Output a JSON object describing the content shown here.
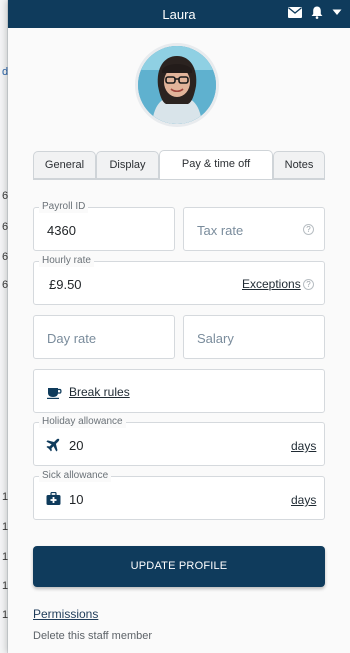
{
  "background_app": {
    "fragments": [
      "d",
      "6",
      "6",
      "6",
      "6",
      "1",
      "1",
      "1",
      "1",
      "1"
    ]
  },
  "header": {
    "title": "Laura",
    "icons": [
      "envelope-icon",
      "bell-icon",
      "chevron-down-icon"
    ]
  },
  "profile": {
    "avatar": "profile-photo"
  },
  "tabs": [
    {
      "label": "General",
      "active": false
    },
    {
      "label": "Display",
      "active": false
    },
    {
      "label": "Pay & time off",
      "active": true
    },
    {
      "label": "Notes",
      "active": false
    }
  ],
  "pay": {
    "payroll_id": {
      "legend": "Payroll ID",
      "value": "4360"
    },
    "tax_rate": {
      "placeholder": "Tax rate"
    },
    "hourly_rate": {
      "legend": "Hourly rate",
      "value": "£9.50",
      "exceptions_label": "Exceptions"
    },
    "day_rate": {
      "placeholder": "Day rate"
    },
    "salary": {
      "placeholder": "Salary"
    }
  },
  "break_rules": {
    "label": "Break rules",
    "icon": "coffee-cup-icon"
  },
  "holiday": {
    "legend": "Holiday allowance",
    "value": "20",
    "unit": "days",
    "icon": "airplane-icon"
  },
  "sick": {
    "legend": "Sick allowance",
    "value": "10",
    "unit": "days",
    "icon": "medical-kit-icon"
  },
  "actions": {
    "update_label": "UPDATE PROFILE",
    "permissions_label": "Permissions",
    "delete_label": "Delete this staff member"
  },
  "colors": {
    "primary": "#0f3b5c",
    "border": "#d5d9dd",
    "placeholder": "#7a8c9c"
  }
}
